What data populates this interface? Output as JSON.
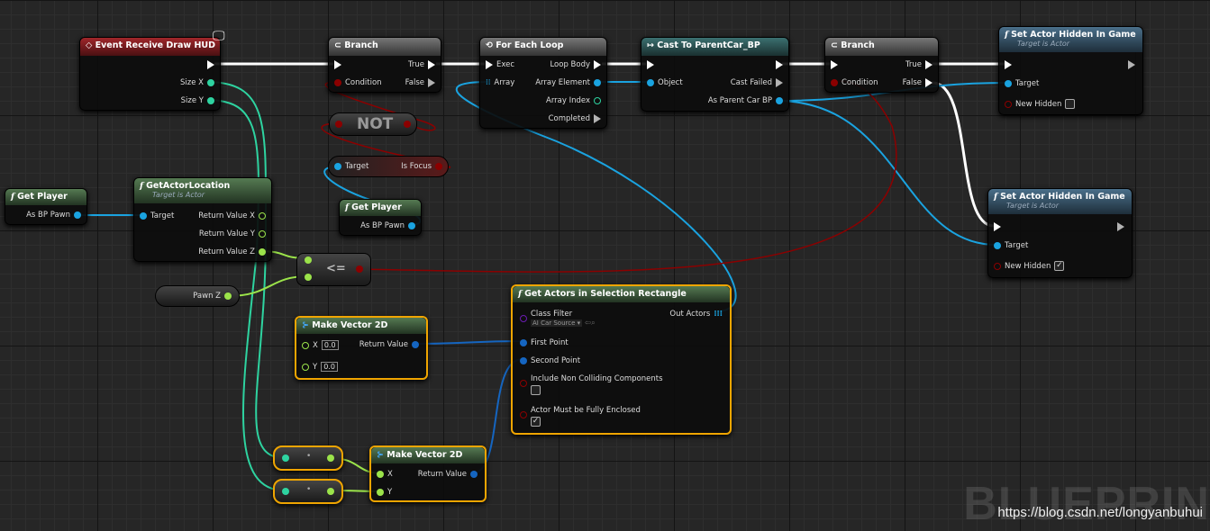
{
  "colors": {
    "exec": "#ffffff",
    "object": "#1aa3e0",
    "bool": "#8b0000",
    "float": "#9be34a",
    "vector2d": "#1565c0",
    "struct": "#2ed3a0",
    "selection": "#f0a500"
  },
  "nodes": {
    "event_draw_hud": {
      "title": "Event Receive Draw HUD",
      "pins": [
        "Size X",
        "Size Y"
      ]
    },
    "branch1": {
      "title": "Branch",
      "pins": [
        "Condition",
        "True",
        "False"
      ]
    },
    "not": {
      "title": "NOT"
    },
    "is_focus": {
      "pins": [
        "Target",
        "Is Focus"
      ]
    },
    "for_each": {
      "title": "For Each Loop",
      "pins": [
        "Exec",
        "Array",
        "Loop Body",
        "Array Element",
        "Array Index",
        "Completed"
      ]
    },
    "cast": {
      "title": "Cast To ParentCar_BP",
      "pins": [
        "Object",
        "Cast Failed",
        "As Parent Car BP"
      ]
    },
    "branch2": {
      "title": "Branch",
      "pins": [
        "Condition",
        "True",
        "False"
      ]
    },
    "set_hidden1": {
      "title": "Set Actor Hidden In Game",
      "subtitle": "Target is Actor",
      "pins": [
        "Target",
        "New Hidden"
      ],
      "new_hidden": false
    },
    "set_hidden2": {
      "title": "Set Actor Hidden In Game",
      "subtitle": "Target is Actor",
      "pins": [
        "Target",
        "New Hidden"
      ],
      "new_hidden": true
    },
    "get_player1": {
      "title": "Get Player",
      "pins": [
        "As BP Pawn"
      ]
    },
    "get_actor_location": {
      "title": "GetActorLocation",
      "subtitle": "Target is Actor",
      "pins": [
        "Target",
        "Return Value X",
        "Return Value Y",
        "Return Value Z"
      ]
    },
    "get_player2": {
      "title": "Get Player",
      "pins": [
        "As BP Pawn"
      ]
    },
    "lte": {
      "title": "<="
    },
    "pawn_z": {
      "title": "Pawn Z"
    },
    "make_vec1": {
      "title": "Make Vector 2D",
      "pins": [
        "X",
        "Y",
        "Return Value"
      ],
      "x": "0.0",
      "y": "0.0"
    },
    "get_actors": {
      "title": "Get Actors in Selection Rectangle",
      "pins": [
        "Class Filter",
        "Out Actors",
        "First Point",
        "Second Point",
        "Include Non Colliding Components",
        "Actor Must be Fully Enclosed"
      ],
      "class_filter": "AI Car Source",
      "include_non_colliding": false,
      "fully_enclosed": true
    },
    "make_vec2": {
      "title": "Make Vector 2D",
      "pins": [
        "X",
        "Y",
        "Return Value"
      ]
    }
  },
  "watermark": "BLUEPRIN",
  "url": "https://blog.csdn.net/longyanbuhui"
}
